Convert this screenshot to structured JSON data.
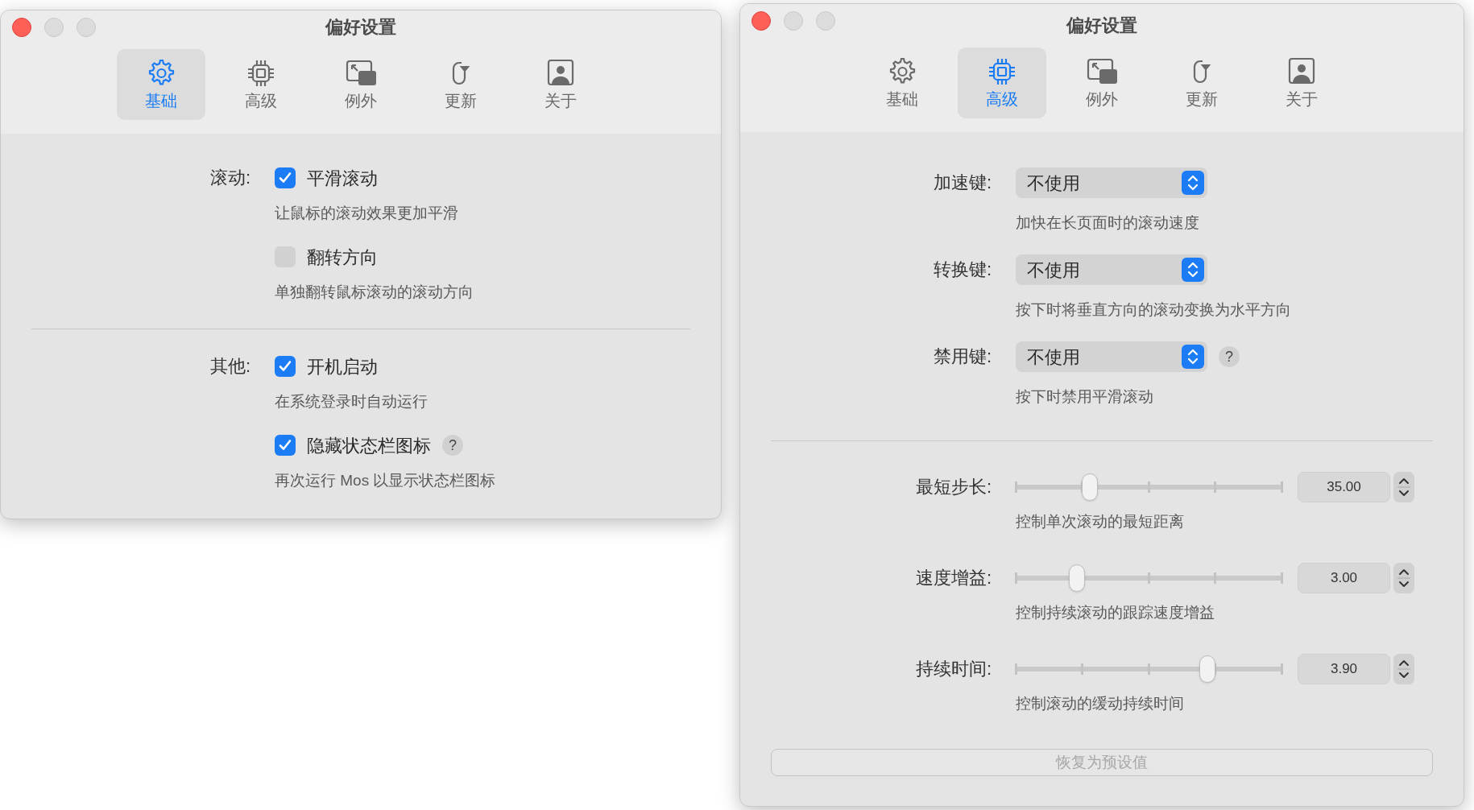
{
  "windows": [
    {
      "title": "偏好设置",
      "tabs": [
        {
          "label": "基础",
          "selected": true
        },
        {
          "label": "高级",
          "selected": false
        },
        {
          "label": "例外",
          "selected": false
        },
        {
          "label": "更新",
          "selected": false
        },
        {
          "label": "关于",
          "selected": false
        }
      ],
      "sections": [
        {
          "label": "滚动:",
          "options": [
            {
              "label": "平滑滚动",
              "checked": true,
              "description": "让鼠标的滚动效果更加平滑"
            },
            {
              "label": "翻转方向",
              "checked": false,
              "description": "单独翻转鼠标滚动的滚动方向"
            }
          ]
        },
        {
          "label": "其他:",
          "options": [
            {
              "label": "开机启动",
              "checked": true,
              "description": "在系统登录时自动运行"
            },
            {
              "label": "隐藏状态栏图标",
              "checked": true,
              "help": "?",
              "description": "再次运行 Mos 以显示状态栏图标"
            }
          ]
        }
      ]
    },
    {
      "title": "偏好设置",
      "tabs": [
        {
          "label": "基础",
          "selected": false
        },
        {
          "label": "高级",
          "selected": true
        },
        {
          "label": "例外",
          "selected": false
        },
        {
          "label": "更新",
          "selected": false
        },
        {
          "label": "关于",
          "selected": false
        }
      ],
      "key_rows": [
        {
          "label": "加速键:",
          "value": "不使用",
          "description": "加快在长页面时的滚动速度"
        },
        {
          "label": "转换键:",
          "value": "不使用",
          "description": "按下时将垂直方向的滚动变换为水平方向"
        },
        {
          "label": "禁用键:",
          "value": "不使用",
          "help": "?",
          "description": "按下时禁用平滑滚动"
        }
      ],
      "sliders": [
        {
          "label": "最短步长:",
          "level": 0.28,
          "value": "35.00",
          "description": "控制单次滚动的最短距离"
        },
        {
          "label": "速度增益:",
          "level": 0.23,
          "value": "3.00",
          "description": "控制持续滚动的跟踪速度增益"
        },
        {
          "label": "持续时间:",
          "level": 0.72,
          "value": "3.90",
          "description": "控制滚动的缓动持续时间"
        }
      ],
      "reset_button": {
        "label": "恢复为预设值",
        "disabled": true
      }
    }
  ]
}
